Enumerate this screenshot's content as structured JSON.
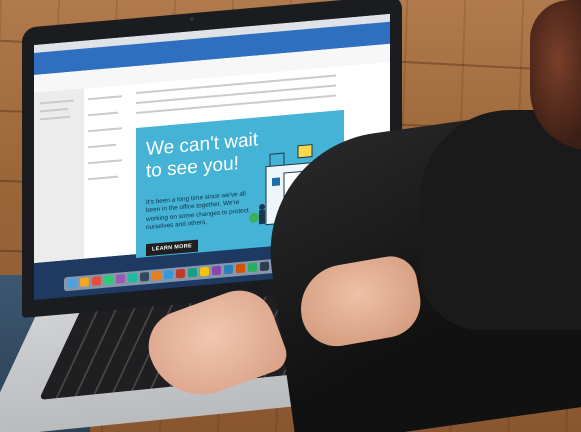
{
  "email": {
    "headline": "We can't wait\nto see you!",
    "body": "It's been a long time since we've all been in the office together. We're working on some changes to protect ourselves and others.",
    "cta_label": "LEARN MORE"
  },
  "colors": {
    "email_background": "#45b3d5",
    "outlook_ribbon": "#2e6fc0",
    "cta_background": "#1f1f1f",
    "desktop": "#1e3a63"
  },
  "icons": [
    "outlook-ribbon",
    "dock-apps",
    "building-illustration",
    "person-illustration"
  ]
}
